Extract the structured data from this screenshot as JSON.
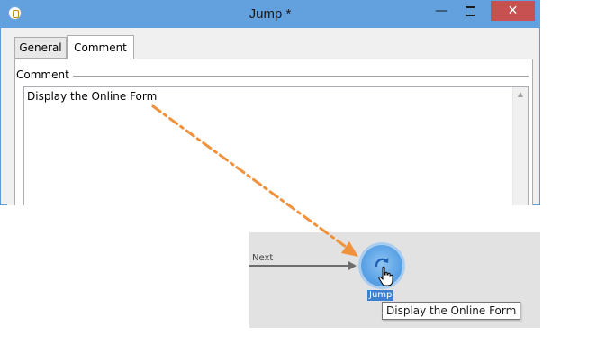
{
  "window": {
    "title": "Jump *",
    "minimize_glyph": "—",
    "close_glyph": "✕"
  },
  "tabs": [
    {
      "label": "General",
      "active": false
    },
    {
      "label": "Comment",
      "active": true
    }
  ],
  "comment_group": {
    "label": "Comment",
    "value": "Display the Online Form"
  },
  "workflow": {
    "transition_label": "Next",
    "node_label": "Jump",
    "tooltip": "Display the Online Form"
  },
  "colors": {
    "titlebar": "#62a1dd",
    "close_button": "#c75050",
    "annotation_arrow": "#f0913c",
    "node_fill": "#5aa2e6",
    "selection": "#3d7fd1"
  },
  "icons": {
    "app": "app-icon",
    "jump": "jump-icon",
    "cursor": "hand-cursor-icon",
    "scroll_up": "scroll-up-arrow-icon"
  }
}
